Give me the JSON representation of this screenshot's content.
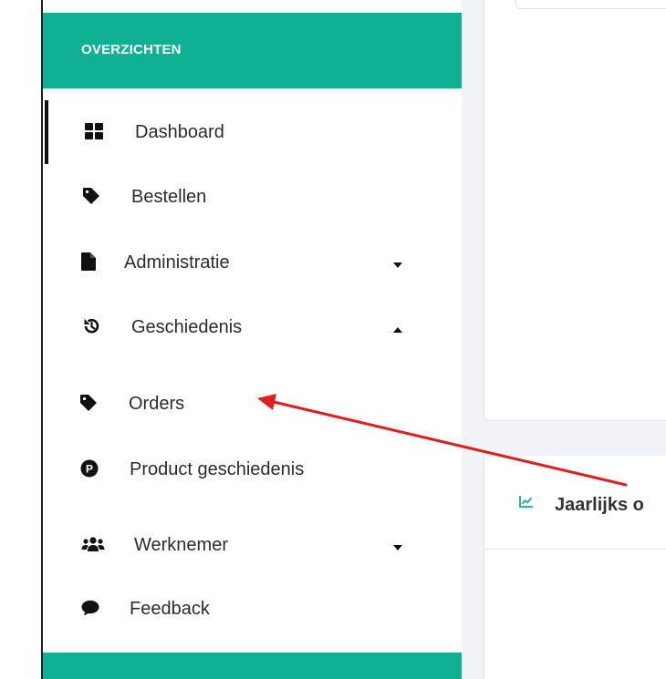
{
  "sidebar": {
    "section_title": "OVERZICHTEN",
    "items": [
      {
        "label": "Dashboard",
        "icon": "dashboard-grid-icon"
      },
      {
        "label": "Bestellen",
        "icon": "tag-icon"
      },
      {
        "label": "Administratie",
        "icon": "file-icon",
        "caret": "down"
      },
      {
        "label": "Geschiedenis",
        "icon": "history-icon",
        "caret": "up"
      },
      {
        "label": "Orders",
        "icon": "tag-icon"
      },
      {
        "label": "Product geschiedenis",
        "icon": "product-p-icon"
      },
      {
        "label": "Werknemer",
        "icon": "users-icon",
        "caret": "down"
      },
      {
        "label": "Feedback",
        "icon": "comment-icon"
      }
    ]
  },
  "main": {
    "yearly_title": "Jaarlijks o",
    "yearly_icon": "line-chart-icon"
  },
  "colors": {
    "accent": "#10b094",
    "annotation_arrow": "#e01e1e",
    "text": "#2b2b2b",
    "main_bg": "#f2f3f6"
  }
}
